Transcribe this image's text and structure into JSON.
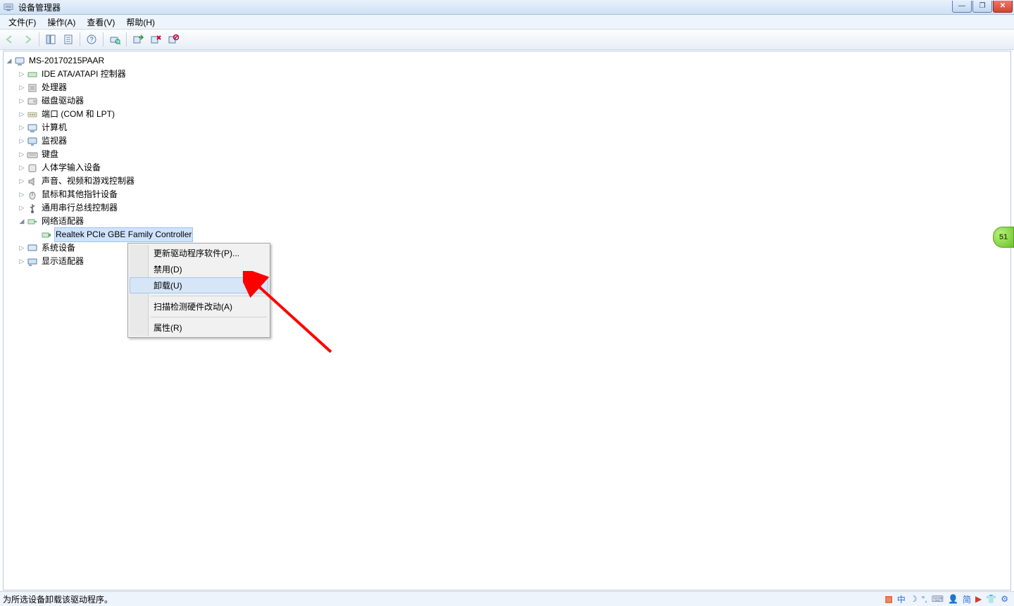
{
  "window": {
    "title": "设备管理器"
  },
  "menu": {
    "items": [
      "文件(F)",
      "操作(A)",
      "查看(V)",
      "帮助(H)"
    ]
  },
  "tree": {
    "root": "MS-20170215PAAR",
    "categories": [
      "IDE ATA/ATAPI 控制器",
      "处理器",
      "磁盘驱动器",
      "端口 (COM 和 LPT)",
      "计算机",
      "监视器",
      "键盘",
      "人体学输入设备",
      "声音、视频和游戏控制器",
      "鼠标和其他指针设备",
      "通用串行总线控制器",
      "网络适配器",
      "系统设备",
      "显示适配器"
    ],
    "selected_device": "Realtek PCIe GBE Family Controller"
  },
  "context_menu": {
    "items": [
      "更新驱动程序软件(P)...",
      "禁用(D)",
      "卸载(U)",
      "扫描检测硬件改动(A)",
      "属性(R)"
    ],
    "hover_index": 2
  },
  "statusbar": {
    "text": "为所选设备卸载该驱动程序。"
  },
  "tray": {
    "ime1": "中",
    "ime2": "简"
  },
  "badge": {
    "text": "51"
  }
}
